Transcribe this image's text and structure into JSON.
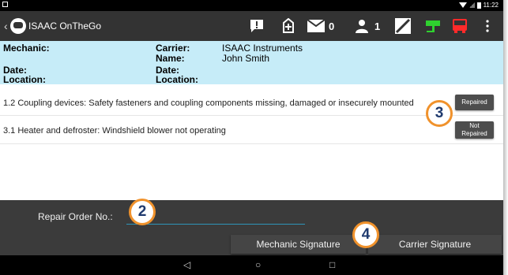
{
  "statusbar": {
    "time": "11:22"
  },
  "appbar": {
    "title": "ISAAC OnTheGo",
    "message_count": "0",
    "user_count": "1",
    "colors": {
      "bar": "#333333",
      "trailer_icon": "#2fd12f",
      "truck_icon": "#ff2a2a"
    }
  },
  "info": {
    "mechanic_label": "Mechanic:",
    "mechanic_date_label": "Date:",
    "location_label": "Location:",
    "carrier_label": "Carrier:",
    "carrier_value": "ISAAC Instruments",
    "name_label": "Name:",
    "name_value": "John Smith",
    "carrier_date_label": "Date:",
    "carrier_location_label": "Location:",
    "background": "#c6ecf8"
  },
  "defects": [
    {
      "text": "1.2 Coupling devices: Safety fasteners and coupling components missing, damaged or insecurely mounted",
      "status": "Repaired"
    },
    {
      "text": "3.1 Heater and defroster: Windshield blower not operating",
      "status_line1": "Not",
      "status_line2": "Repaired"
    }
  ],
  "repair": {
    "label": "Repair Order No.:",
    "value": "",
    "placeholder": ""
  },
  "signatures": {
    "mechanic": "Mechanic Signature",
    "carrier": "Carrier Signature"
  },
  "navbar": {
    "back": "◁",
    "home": "○",
    "recents": "□"
  },
  "callouts": {
    "c2": "2",
    "c3": "3",
    "c4": "4",
    "color": "#f0922c"
  }
}
